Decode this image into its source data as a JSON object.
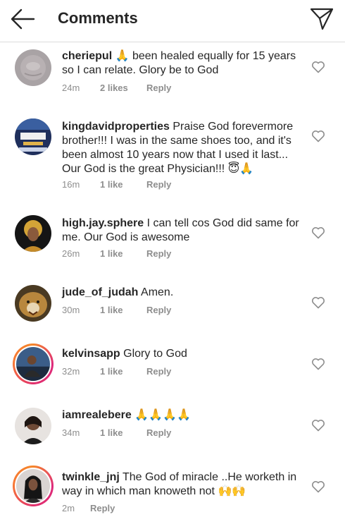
{
  "header": {
    "title": "Comments",
    "back_icon": "arrow-left-icon",
    "send_icon": "paper-plane-icon"
  },
  "comments": [
    {
      "username": "cheriepul",
      "text": "🙏 been healed equally for 15 years so I can relate. Glory be to God",
      "time": "24m",
      "likes": "2 likes",
      "reply": "Reply"
    },
    {
      "username": "kingdavidproperties",
      "text": "Praise God forevermore brother!!! I was in the same shoes too, and it's been almost 10 years now that I used it last... Our God is the great Physician!!! 😇🙏",
      "time": "16m",
      "likes": "1 like",
      "reply": "Reply"
    },
    {
      "username": "high.jay.sphere",
      "text": "I can tell cos God did same for me. Our God is awesome",
      "time": "26m",
      "likes": "1 like",
      "reply": "Reply"
    },
    {
      "username": "jude_of_judah",
      "text": "Amen.",
      "time": "30m",
      "likes": "1 like",
      "reply": "Reply"
    },
    {
      "username": "kelvinsapp",
      "text": "Glory to God",
      "time": "32m",
      "likes": "1 like",
      "reply": "Reply"
    },
    {
      "username": "iamrealebere",
      "text": "🙏🙏🙏🙏",
      "time": "34m",
      "likes": "1 like",
      "reply": "Reply"
    },
    {
      "username": "twinkle_jnj",
      "text": "The God of miracle ..He worketh in way in which man knoweth not 🙌🙌",
      "time": "2m",
      "likes": "",
      "reply": "Reply"
    }
  ],
  "colors": {
    "text": "#262626",
    "meta": "#8e8e8e",
    "divider": "#dbdbdb",
    "story_ring": "#dd2a7b"
  }
}
